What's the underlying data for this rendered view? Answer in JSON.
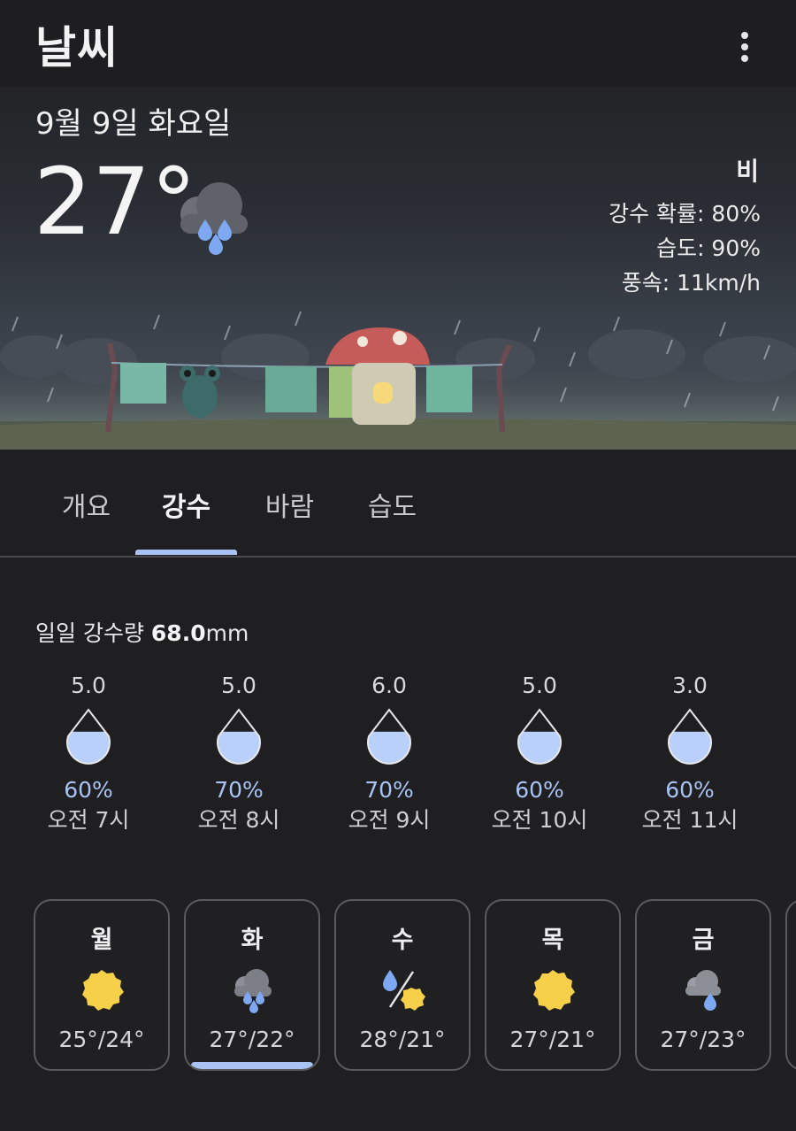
{
  "app": {
    "title": "날씨",
    "menu_icon": "more-vert-icon"
  },
  "hero": {
    "date": "9월 9일 화요일",
    "temperature": "27°",
    "condition_icon": "rain-cloud-icon",
    "condition": "비",
    "precip_chance": "강수 확률: 80%",
    "humidity": "습도: 90%",
    "wind": "풍속: 11km/h"
  },
  "tabs": [
    {
      "label": "개요",
      "active": false
    },
    {
      "label": "강수",
      "active": true
    },
    {
      "label": "바람",
      "active": false
    },
    {
      "label": "습도",
      "active": false
    }
  ],
  "precip": {
    "daily_label": "일일 강수량 ",
    "daily_value": "68.0",
    "daily_unit": "mm",
    "hourly": [
      {
        "amount": "5.0",
        "probability": "60%",
        "fill": 0.6,
        "time": "오전 7시"
      },
      {
        "amount": "5.0",
        "probability": "70%",
        "fill": 0.6,
        "time": "오전 8시"
      },
      {
        "amount": "6.0",
        "probability": "70%",
        "fill": 0.6,
        "time": "오전 9시"
      },
      {
        "amount": "5.0",
        "probability": "60%",
        "fill": 0.6,
        "time": "오전 10시"
      },
      {
        "amount": "3.0",
        "probability": "60%",
        "fill": 0.6,
        "time": "오전 11시"
      }
    ]
  },
  "forecast": [
    {
      "day": "월",
      "icon": "sunny-icon",
      "temps": "25°/24°",
      "selected": false
    },
    {
      "day": "화",
      "icon": "rain-cloud-icon",
      "temps": "27°/22°",
      "selected": true
    },
    {
      "day": "수",
      "icon": "rain-and-sun-icon",
      "temps": "28°/21°",
      "selected": false
    },
    {
      "day": "목",
      "icon": "sunny-icon",
      "temps": "27°/21°",
      "selected": false
    },
    {
      "day": "금",
      "icon": "cloud-drizzle-icon",
      "temps": "27°/23°",
      "selected": false
    }
  ],
  "colors": {
    "accent": "#a9c3f5",
    "sun": "#f7d04a",
    "rain": "#7fa8f2",
    "cloud": "#8c8f96"
  }
}
